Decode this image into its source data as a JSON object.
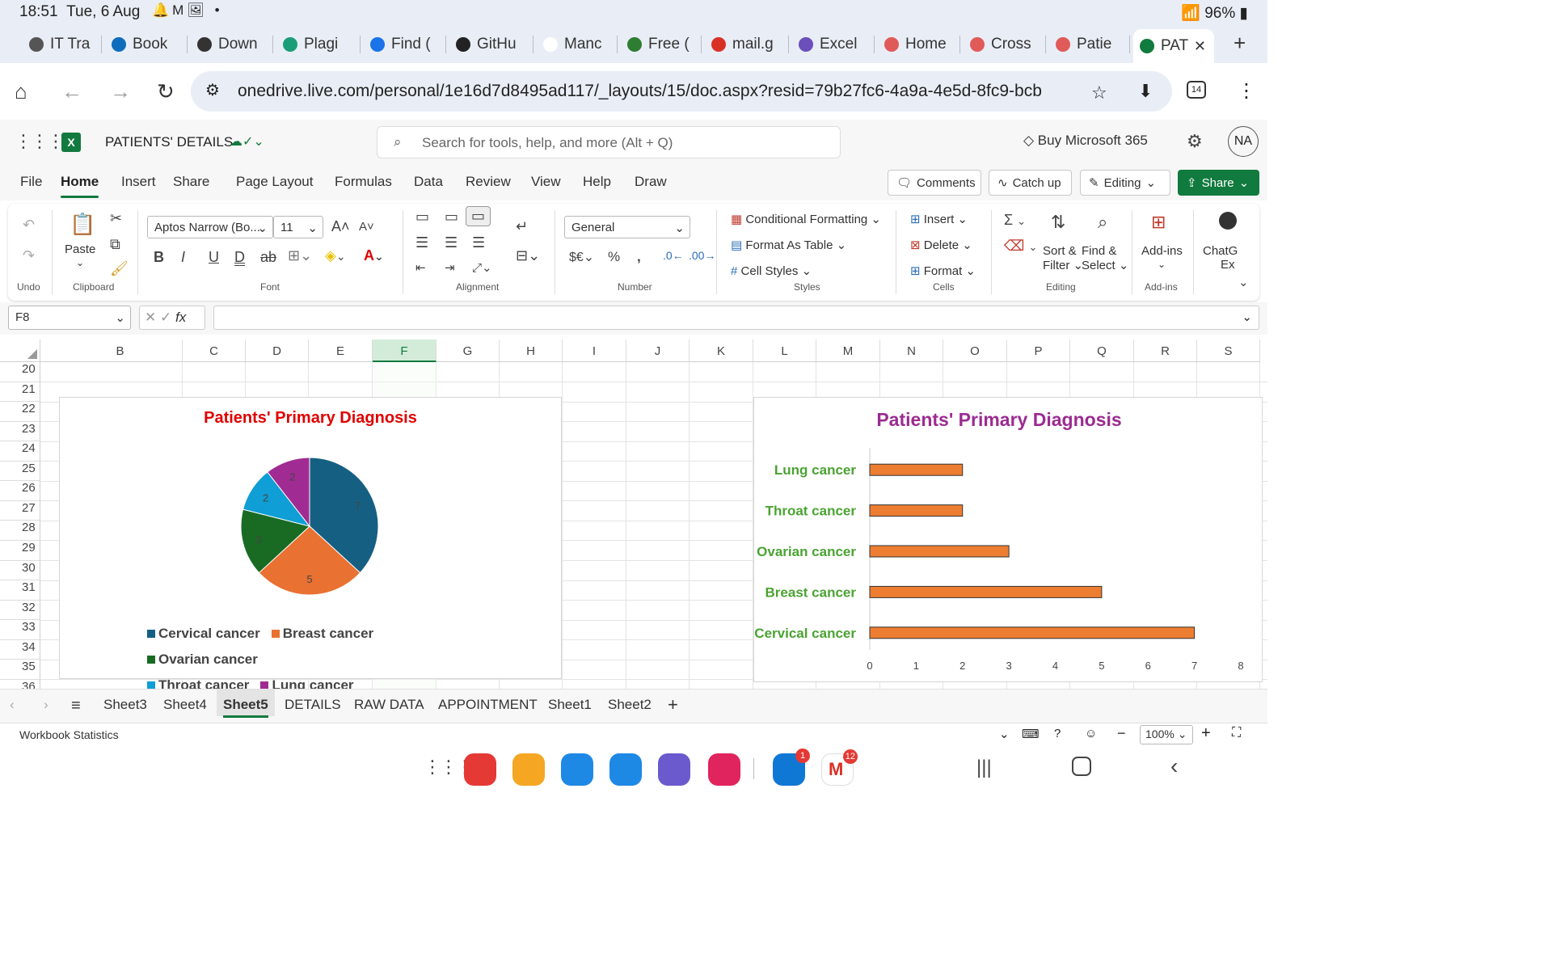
{
  "status_bar": {
    "time": "18:51",
    "date": "Tue, 6 Aug",
    "notif_icons": "🔔M🖼 •",
    "battery": "96%"
  },
  "browser": {
    "tabs": [
      {
        "label": "IT Tra",
        "color": "#555555"
      },
      {
        "label": "Book",
        "color": "#0f6cbd"
      },
      {
        "label": "Down",
        "color": "#333333"
      },
      {
        "label": "Plagi",
        "color": "#1b9e77"
      },
      {
        "label": "Find (",
        "color": "#1a73e8"
      },
      {
        "label": "GitHu",
        "color": "#222222"
      },
      {
        "label": "Manc",
        "color": "#ffffff"
      },
      {
        "label": "Free (",
        "color": "#2e7d32"
      },
      {
        "label": "mail.g",
        "color": "#d93025"
      },
      {
        "label": "Excel",
        "color": "#6b4fbb"
      },
      {
        "label": "Home",
        "color": "#e05a5a"
      },
      {
        "label": "Cross",
        "color": "#e05a5a"
      },
      {
        "label": "Patie",
        "color": "#e05a5a"
      },
      {
        "label": "PAT",
        "color": "#117a3e"
      }
    ],
    "url": "onedrive.live.com/personal/1e16d7d8495ad117/_layouts/15/doc.aspx?resid=79b27fc6-4a9a-4e5d-8fc9-bcb",
    "tab_count": "14"
  },
  "app": {
    "doc_title": "PATIENTS' DETAILS",
    "search_placeholder": "Search for tools, help, and more (Alt + Q)",
    "buy": "Buy Microsoft 365",
    "avatar": "NA"
  },
  "menu": {
    "items": [
      "File",
      "Home",
      "Insert",
      "Share",
      "Page Layout",
      "Formulas",
      "Data",
      "Review",
      "View",
      "Help",
      "Draw"
    ],
    "comments": "Comments",
    "catch_up": "Catch up",
    "editing": "Editing",
    "share": "Share"
  },
  "ribbon": {
    "undo_group": "Undo",
    "paste": "Paste",
    "clipboard_group": "Clipboard",
    "font_name": "Aptos Narrow (Bo...",
    "font_size": "11",
    "font_group": "Font",
    "alignment_group": "Alignment",
    "number_format": "General",
    "number_group": "Number",
    "cond_format": "Conditional Formatting",
    "format_table": "Format As Table",
    "cell_styles": "Cell Styles",
    "styles_group": "Styles",
    "insert": "Insert",
    "delete": "Delete",
    "format": "Format",
    "cells_group": "Cells",
    "sort1": "Sort &",
    "sort2": "Filter",
    "find1": "Find &",
    "find2": "Select",
    "editing_group": "Editing",
    "addins": "Add-ins",
    "addins_group": "Add-ins",
    "chat1": "ChatG",
    "chat2": "Ex"
  },
  "formula_bar": {
    "name_box": "F8",
    "formula": ""
  },
  "grid": {
    "columns": [
      "B",
      "C",
      "D",
      "E",
      "F",
      "G",
      "H",
      "I",
      "J",
      "K",
      "L",
      "M",
      "N",
      "O",
      "P",
      "Q",
      "R",
      "S"
    ],
    "selected_column": "F",
    "rows": [
      "20",
      "21",
      "22",
      "23",
      "24",
      "25",
      "26",
      "27",
      "28",
      "29",
      "30",
      "31",
      "32",
      "33",
      "34",
      "35",
      "36"
    ]
  },
  "chart_data": [
    {
      "type": "pie",
      "title": "Patients' Primary Diagnosis",
      "title_color": "#e00000",
      "categories": [
        "Cervical cancer",
        "Breast cancer",
        "Ovarian cancer",
        "Throat cancer",
        "Lung cancer"
      ],
      "values": [
        7,
        5,
        3,
        2,
        2
      ],
      "colors": [
        "#156082",
        "#e97132",
        "#196b24",
        "#0f9ed5",
        "#a02b93"
      ],
      "legend": "bottom"
    },
    {
      "type": "bar",
      "orientation": "horizontal",
      "title": "Patients' Primary Diagnosis",
      "title_color": "#9b2b92",
      "categories": [
        "Lung cancer",
        "Throat cancer",
        "Ovarian cancer",
        "Breast cancer",
        "Cervical cancer"
      ],
      "values": [
        2,
        2,
        3,
        5,
        7
      ],
      "bar_color": "#ed7d31",
      "label_color": "#4aa332",
      "x_ticks": [
        "0",
        "1",
        "2",
        "3",
        "4",
        "5",
        "6",
        "7",
        "8"
      ],
      "xlim": [
        0,
        8
      ]
    }
  ],
  "sheets": {
    "tabs": [
      "Sheet3",
      "Sheet4",
      "Sheet5",
      "DETAILS",
      "RAW DATA",
      "APPOINTMENT",
      "Sheet1",
      "Sheet2"
    ],
    "selected": "Sheet5"
  },
  "status": {
    "workbook_stats": "Workbook Statistics",
    "zoom": "100%"
  },
  "dock": {
    "apps": [
      {
        "name": "app-red",
        "color": "#e53935"
      },
      {
        "name": "app-files",
        "color": "#f5a623"
      },
      {
        "name": "app-calendar",
        "color": "#1e88e5"
      },
      {
        "name": "app-messages",
        "color": "#1e88e5"
      },
      {
        "name": "app-browser",
        "color": "#6a5acd"
      },
      {
        "name": "app-camera",
        "color": "#e0245e"
      },
      {
        "name": "app-onedrive",
        "color": "#0f78d4"
      },
      {
        "name": "app-gmail",
        "color": "#ffffff"
      }
    ],
    "onedrive_badge": "1",
    "gmail_badge": "12"
  }
}
